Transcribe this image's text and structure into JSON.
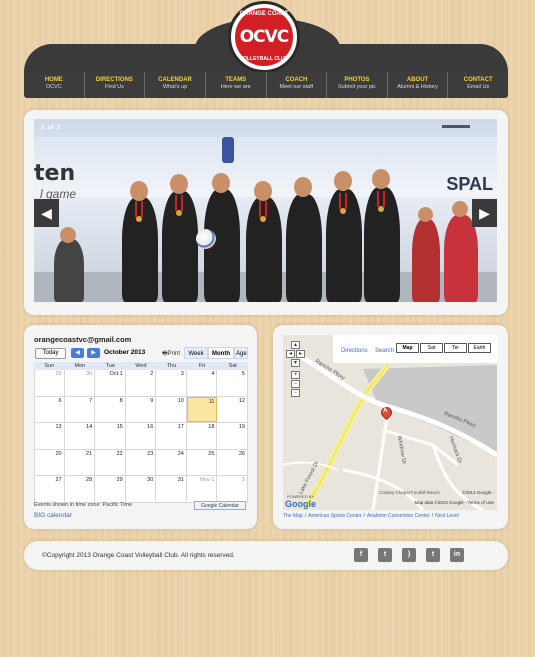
{
  "logo": {
    "main": "OCVC",
    "arc_top": "ORANGE COAST",
    "arc_bottom": "VOLLEYBALL CLUB"
  },
  "nav": [
    {
      "title": "HOME",
      "sub": "OCVC"
    },
    {
      "title": "DIRECTIONS",
      "sub": "Find Us"
    },
    {
      "title": "CALENDAR",
      "sub": "What's up"
    },
    {
      "title": "TEAMS",
      "sub": "Here we are"
    },
    {
      "title": "COACH",
      "sub": "Meet our staff"
    },
    {
      "title": "PHOTOS",
      "sub": "Submit your pic"
    },
    {
      "title": "ABOUT",
      "sub": "Alumni & History"
    },
    {
      "title": "CONTACT",
      "sub": "Email Us"
    }
  ],
  "slider": {
    "current": "1",
    "of": "of",
    "total": "3",
    "prev_glyph": "◀",
    "next_glyph": "▶",
    "banner_left": "ten",
    "banner_left_sub": "l game",
    "banner_right": "SPAL"
  },
  "calendar": {
    "title": "orangecoastvc@gmail.com",
    "today_label": "Today",
    "prev_glyph": "◀",
    "next_glyph": "▶",
    "month": "October 2013",
    "print": "Print",
    "tabs": [
      "Week",
      "Month",
      "Agenda"
    ],
    "active_tab": "Month",
    "day_headers": [
      "Sun",
      "Mon",
      "Tue",
      "Wed",
      "Thu",
      "Fri",
      "Sat"
    ],
    "weeks": [
      [
        "29",
        "30",
        "Oct 1",
        "2",
        "3",
        "4",
        "5"
      ],
      [
        "6",
        "7",
        "8",
        "9",
        "10",
        "11",
        "12"
      ],
      [
        "13",
        "14",
        "15",
        "16",
        "17",
        "18",
        "19"
      ],
      [
        "20",
        "21",
        "22",
        "23",
        "24",
        "25",
        "26"
      ],
      [
        "27",
        "28",
        "29",
        "30",
        "31",
        "Nov 1",
        "2"
      ]
    ],
    "today_date": "11",
    "timezone_note": "Events shown in time zone: Pacific Time",
    "badge": "Google Calendar",
    "big_link": "BIG calendar"
  },
  "map": {
    "directions": "Directions",
    "search": "Search",
    "types": [
      "Map",
      "Sat",
      "Ter",
      "Earth"
    ],
    "active_type": "Map",
    "labels": {
      "rancho_top": "Rancho Pkwy",
      "rancho_right": "Rancho Pkwy",
      "windrow": "Windrow Dr",
      "hemiara": "Hemiara Dr",
      "lake_forest": "Lake Forest Dr",
      "calvary": "Calvary Chapel Foothill Ranch",
      "pin": "A"
    },
    "powered_by": "POWERED BY",
    "google": "Google",
    "copy_line1": "©2013 Google -",
    "copy_line2": "Map data ©2013 Google - Terms of Use",
    "bottom_links": [
      "The Map",
      "American Sports Center",
      "Anaheim Convention Center",
      "Next Level"
    ]
  },
  "footer": {
    "copyright": "©Copyright 2013 Orange Coast Volleyball Club. All rights reserved.",
    "social": [
      {
        "name": "facebook-icon",
        "glyph": "f"
      },
      {
        "name": "twitter-icon",
        "glyph": "t"
      },
      {
        "name": "rss-icon",
        "glyph": ")"
      },
      {
        "name": "twitter-alt-icon",
        "glyph": "t"
      },
      {
        "name": "linkedin-icon",
        "glyph": "in"
      }
    ]
  },
  "colors": {
    "nav_title": "#f3d23a",
    "header_bg": "#3a3a3a",
    "logo_red": "#d11f25",
    "link_blue": "#3a6cc4"
  }
}
